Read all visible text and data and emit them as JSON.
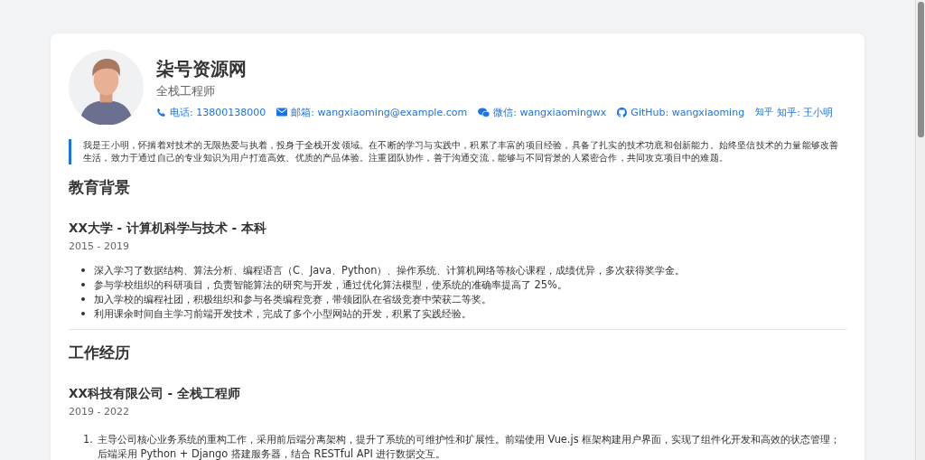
{
  "header": {
    "name": "柒号资源网",
    "title": "全栈工程师",
    "contacts": [
      {
        "kind": "phone",
        "text": "电话: 13800138000"
      },
      {
        "kind": "email",
        "text": "邮箱: wangxiaoming@example.com"
      },
      {
        "kind": "wechat",
        "text": "微信: wangxiaomingwx"
      },
      {
        "kind": "github",
        "text": "GitHub: wangxiaoming"
      },
      {
        "kind": "zhihu",
        "badge": "知乎",
        "text": "知乎: 王小明"
      }
    ]
  },
  "bio": "我是王小明，怀揣着对技术的无限热爱与执着，投身于全栈开发领域。在不断的学习与实践中，积累了丰富的项目经验，具备了扎实的技术功底和创新能力。始终坚信技术的力量能够改善生活，致力于通过自己的专业知识为用户打造高效、优质的产品体验。注重团队协作，善于沟通交流，能够与不同背景的人紧密合作，共同攻克项目中的难题。",
  "sections": [
    {
      "title": "教育背景",
      "entries": [
        {
          "heading": "XX大学 - 计算机科学与技术 - 本科",
          "period": "2015 - 2019",
          "kind": "bullet",
          "items": [
            {
              "text": "深入学习了数据结构、算法分析、编程语言（C、Java、Python）、操作系统、计算机网络等核心课程，成绩优异，多次获得奖学金。"
            },
            {
              "text": "参与学校组织的科研项目，负责智能算法的研究与开发，通过优化算法模型，使系统的准确率提高了 25%。"
            },
            {
              "text": "加入学校的编程社团，积极组织和参与各类编程竞赛，带领团队在省级竞赛中荣获二等奖。"
            },
            {
              "text": "利用课余时间自主学习前端开发技术，完成了多个小型网站的开发，积累了实践经验。"
            }
          ]
        }
      ]
    },
    {
      "title": "工作经历",
      "entries": [
        {
          "heading": "XX科技有限公司 - 全栈工程师",
          "period": "2019 - 2022",
          "kind": "numbered",
          "items": [
            {
              "marker": "1.",
              "text": "主导公司核心业务系统的重构工作，采用前后端分离架构，提升了系统的可维护性和扩展性。前端使用 Vue.js 框架构建用户界面，实现了组件化开发和高效的状态管理；后端采用 Python + Django 搭建服务器，结合 RESTful API 进行数据交互。"
            }
          ]
        }
      ]
    }
  ]
}
